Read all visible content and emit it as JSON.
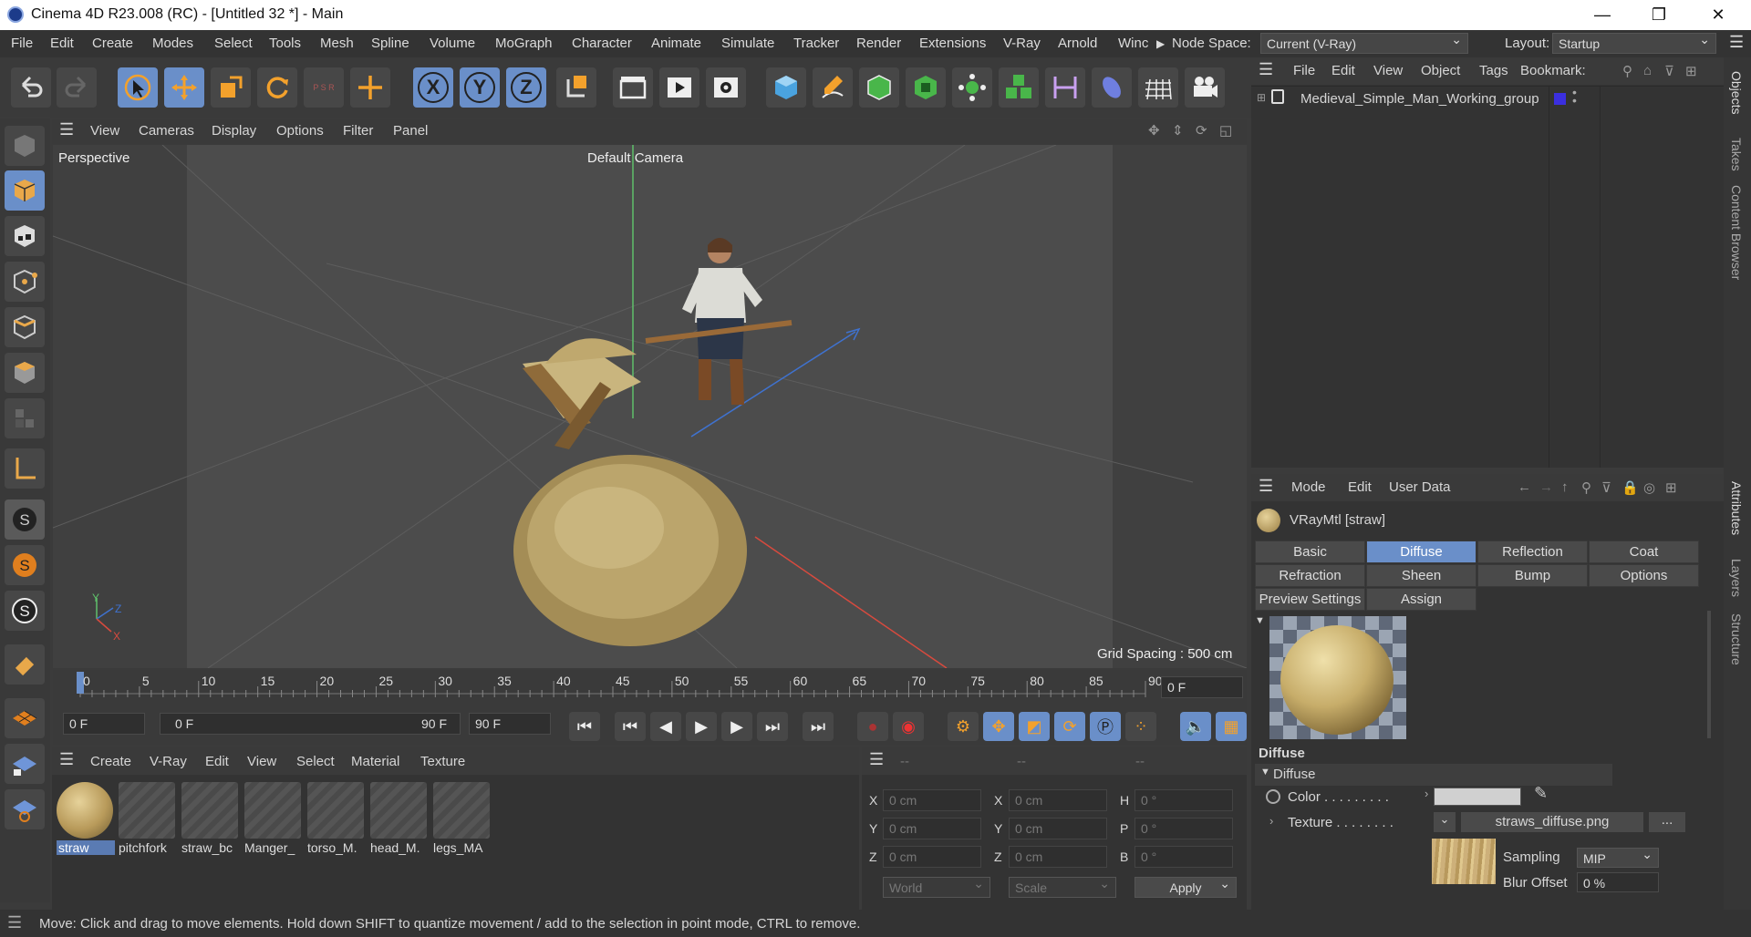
{
  "window": {
    "title": "Cinema 4D R23.008 (RC) - [Untitled 32 *] - Main",
    "minimize": "—",
    "maximize": "❐",
    "close": "✕"
  },
  "menubar": {
    "items": [
      "File",
      "Edit",
      "Create",
      "Modes",
      "Select",
      "Tools",
      "Mesh",
      "Spline",
      "Volume",
      "MoGraph",
      "Character",
      "Animate",
      "Simulate",
      "Tracker",
      "Render",
      "Extensions",
      "V-Ray",
      "Arnold",
      "Winc"
    ],
    "node_space_label": "Node Space:",
    "node_space_value": "Current (V-Ray)",
    "layout_label": "Layout:",
    "layout_value": "Startup"
  },
  "toolbar": {
    "axis_x": "X",
    "axis_y": "Y",
    "axis_z": "Z",
    "psr": "P S R"
  },
  "viewport": {
    "menu": [
      "View",
      "Cameras",
      "Display",
      "Options",
      "Filter",
      "Panel"
    ],
    "label": "Perspective",
    "camera": "Default Camera",
    "grid": "Grid Spacing : 500 cm",
    "gizmo_y": "Y",
    "gizmo_z": "Z",
    "gizmo_x": "X"
  },
  "timeline": {
    "ticks": [
      "0",
      "5",
      "10",
      "15",
      "20",
      "25",
      "30",
      "35",
      "40",
      "45",
      "50",
      "55",
      "60",
      "65",
      "70",
      "75",
      "80",
      "85",
      "90"
    ],
    "current_frame": "0 F"
  },
  "transport": {
    "start": "0 F",
    "range_start": "0 F",
    "range_end": "90 F",
    "end": "90 F"
  },
  "material_manager": {
    "menu": [
      "Create",
      "V-Ray",
      "Edit",
      "View",
      "Select",
      "Material",
      "Texture"
    ],
    "materials": [
      "straw",
      "pitchfork",
      "straw_bc",
      "Manger_",
      "torso_M.",
      "head_M.",
      "legs_MA"
    ]
  },
  "coordinates": {
    "headers": [
      "--",
      "--",
      "--"
    ],
    "rows": [
      {
        "a": "X",
        "av": "0 cm",
        "b": "X",
        "bv": "0 cm",
        "c": "H",
        "cv": "0 °"
      },
      {
        "a": "Y",
        "av": "0 cm",
        "b": "Y",
        "bv": "0 cm",
        "c": "P",
        "cv": "0 °"
      },
      {
        "a": "Z",
        "av": "0 cm",
        "b": "Z",
        "bv": "0 cm",
        "c": "B",
        "cv": "0 °"
      }
    ],
    "world": "World",
    "scale": "Scale",
    "apply": "Apply"
  },
  "objects": {
    "menu": [
      "File",
      "Edit",
      "View",
      "Object",
      "Tags",
      "Bookmark:"
    ],
    "items": [
      {
        "name": "Medieval_Simple_Man_Working_group",
        "color": "#3b2fe0"
      }
    ]
  },
  "attributes": {
    "menu": [
      "Mode",
      "Edit",
      "User Data"
    ],
    "material_title": "VRayMtl [straw]",
    "tabs": [
      "Basic",
      "Diffuse",
      "Reflection",
      "Coat",
      "Refraction",
      "Sheen",
      "Bump",
      "Options",
      "Preview Settings",
      "Assign"
    ],
    "active_tab": "Diffuse",
    "section": "Diffuse",
    "group": "Diffuse",
    "color_label": "Color . . . . . . . . .",
    "texture_label": "Texture . . . . . . . .",
    "texture_file": "straws_diffuse.png",
    "more": "...",
    "sampling_label": "Sampling",
    "sampling_value": "MIP",
    "blur_label": "Blur Offset",
    "blur_value": "0 %"
  },
  "side_tabs": [
    "Objects",
    "Takes",
    "Content Browser",
    "Attributes",
    "Layers",
    "Structure"
  ],
  "status": {
    "text": "Move: Click and drag to move elements. Hold down SHIFT to quantize movement / add to the selection in point mode, CTRL to remove."
  }
}
